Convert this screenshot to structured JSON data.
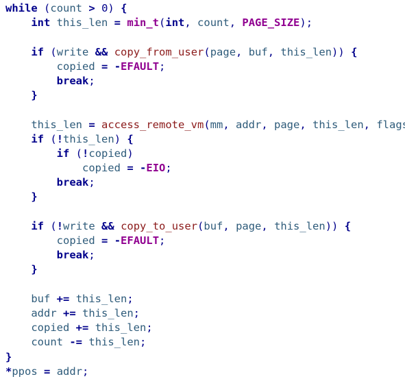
{
  "editor": {
    "language": "c",
    "background_color": "#ffffff",
    "font_size_px": 15.5,
    "line_height_px": 21.2,
    "tab_width_spaces": 4,
    "theme": {
      "keyword_color": "#00008b",
      "macro_color": "#900090",
      "function_color": "#8b1a1a",
      "identifier_color": "#2e5b7a",
      "operator_color": "#00008b",
      "number_color": "#00008b"
    }
  },
  "code": {
    "lines": [
      {
        "index": 1,
        "text": "while (count > 0) {",
        "tokens": [
          {
            "t": "while",
            "c": "t-kw"
          },
          {
            "t": " ",
            "c": "t-plain"
          },
          {
            "t": "(",
            "c": "t-pun"
          },
          {
            "t": "count",
            "c": "t-var"
          },
          {
            "t": " ",
            "c": "t-plain"
          },
          {
            "t": ">",
            "c": "t-op"
          },
          {
            "t": " ",
            "c": "t-plain"
          },
          {
            "t": "0",
            "c": "t-num"
          },
          {
            "t": ")",
            "c": "t-pun"
          },
          {
            "t": " ",
            "c": "t-plain"
          },
          {
            "t": "{",
            "c": "t-brace"
          }
        ]
      },
      {
        "index": 2,
        "text": "    int this_len = min_t(int, count, PAGE_SIZE);",
        "tokens": [
          {
            "t": "    ",
            "c": "t-plain"
          },
          {
            "t": "int",
            "c": "t-kw"
          },
          {
            "t": " ",
            "c": "t-plain"
          },
          {
            "t": "this_len",
            "c": "t-var"
          },
          {
            "t": " ",
            "c": "t-plain"
          },
          {
            "t": "=",
            "c": "t-op"
          },
          {
            "t": " ",
            "c": "t-plain"
          },
          {
            "t": "min_t",
            "c": "t-mac"
          },
          {
            "t": "(",
            "c": "t-pun"
          },
          {
            "t": "int",
            "c": "t-kw"
          },
          {
            "t": ", ",
            "c": "t-pun"
          },
          {
            "t": "count",
            "c": "t-var"
          },
          {
            "t": ", ",
            "c": "t-pun"
          },
          {
            "t": "PAGE_SIZE",
            "c": "t-mac"
          },
          {
            "t": ");",
            "c": "t-pun"
          }
        ]
      },
      {
        "index": 3,
        "text": "",
        "tokens": []
      },
      {
        "index": 4,
        "text": "    if (write && copy_from_user(page, buf, this_len)) {",
        "tokens": [
          {
            "t": "    ",
            "c": "t-plain"
          },
          {
            "t": "if",
            "c": "t-kw"
          },
          {
            "t": " ",
            "c": "t-plain"
          },
          {
            "t": "(",
            "c": "t-pun"
          },
          {
            "t": "write",
            "c": "t-var"
          },
          {
            "t": " ",
            "c": "t-plain"
          },
          {
            "t": "&&",
            "c": "t-op"
          },
          {
            "t": " ",
            "c": "t-plain"
          },
          {
            "t": "copy_from_user",
            "c": "t-fn"
          },
          {
            "t": "(",
            "c": "t-pun"
          },
          {
            "t": "page",
            "c": "t-var"
          },
          {
            "t": ", ",
            "c": "t-pun"
          },
          {
            "t": "buf",
            "c": "t-var"
          },
          {
            "t": ", ",
            "c": "t-pun"
          },
          {
            "t": "this_len",
            "c": "t-var"
          },
          {
            "t": "))",
            "c": "t-pun"
          },
          {
            "t": " ",
            "c": "t-plain"
          },
          {
            "t": "{",
            "c": "t-brace"
          }
        ]
      },
      {
        "index": 5,
        "text": "        copied = -EFAULT;",
        "tokens": [
          {
            "t": "        ",
            "c": "t-plain"
          },
          {
            "t": "copied",
            "c": "t-var"
          },
          {
            "t": " ",
            "c": "t-plain"
          },
          {
            "t": "=",
            "c": "t-op"
          },
          {
            "t": " ",
            "c": "t-plain"
          },
          {
            "t": "-",
            "c": "t-op"
          },
          {
            "t": "EFAULT",
            "c": "t-mac"
          },
          {
            "t": ";",
            "c": "t-pun"
          }
        ]
      },
      {
        "index": 6,
        "text": "        break;",
        "tokens": [
          {
            "t": "        ",
            "c": "t-plain"
          },
          {
            "t": "break",
            "c": "t-kw"
          },
          {
            "t": ";",
            "c": "t-pun"
          }
        ]
      },
      {
        "index": 7,
        "text": "    }",
        "tokens": [
          {
            "t": "    ",
            "c": "t-plain"
          },
          {
            "t": "}",
            "c": "t-brace"
          }
        ]
      },
      {
        "index": 8,
        "text": "",
        "tokens": []
      },
      {
        "index": 9,
        "text": "    this_len = access_remote_vm(mm, addr, page, this_len, flags)",
        "tokens": [
          {
            "t": "    ",
            "c": "t-plain"
          },
          {
            "t": "this_len",
            "c": "t-var"
          },
          {
            "t": " ",
            "c": "t-plain"
          },
          {
            "t": "=",
            "c": "t-op"
          },
          {
            "t": " ",
            "c": "t-plain"
          },
          {
            "t": "access_remote_vm",
            "c": "t-fn"
          },
          {
            "t": "(",
            "c": "t-pun"
          },
          {
            "t": "mm",
            "c": "t-var"
          },
          {
            "t": ", ",
            "c": "t-pun"
          },
          {
            "t": "addr",
            "c": "t-var"
          },
          {
            "t": ", ",
            "c": "t-pun"
          },
          {
            "t": "page",
            "c": "t-var"
          },
          {
            "t": ", ",
            "c": "t-pun"
          },
          {
            "t": "this_len",
            "c": "t-var"
          },
          {
            "t": ", ",
            "c": "t-pun"
          },
          {
            "t": "flags",
            "c": "t-var"
          },
          {
            "t": ")",
            "c": "t-pun"
          }
        ]
      },
      {
        "index": 10,
        "text": "    if (!this_len) {",
        "tokens": [
          {
            "t": "    ",
            "c": "t-plain"
          },
          {
            "t": "if",
            "c": "t-kw"
          },
          {
            "t": " ",
            "c": "t-plain"
          },
          {
            "t": "(",
            "c": "t-pun"
          },
          {
            "t": "!",
            "c": "t-op"
          },
          {
            "t": "this_len",
            "c": "t-var"
          },
          {
            "t": ")",
            "c": "t-pun"
          },
          {
            "t": " ",
            "c": "t-plain"
          },
          {
            "t": "{",
            "c": "t-brace"
          }
        ]
      },
      {
        "index": 11,
        "text": "        if (!copied)",
        "tokens": [
          {
            "t": "        ",
            "c": "t-plain"
          },
          {
            "t": "if",
            "c": "t-kw"
          },
          {
            "t": " ",
            "c": "t-plain"
          },
          {
            "t": "(",
            "c": "t-pun"
          },
          {
            "t": "!",
            "c": "t-op"
          },
          {
            "t": "copied",
            "c": "t-var"
          },
          {
            "t": ")",
            "c": "t-pun"
          }
        ]
      },
      {
        "index": 12,
        "text": "            copied = -EIO;",
        "tokens": [
          {
            "t": "            ",
            "c": "t-plain"
          },
          {
            "t": "copied",
            "c": "t-var"
          },
          {
            "t": " ",
            "c": "t-plain"
          },
          {
            "t": "=",
            "c": "t-op"
          },
          {
            "t": " ",
            "c": "t-plain"
          },
          {
            "t": "-",
            "c": "t-op"
          },
          {
            "t": "EIO",
            "c": "t-mac"
          },
          {
            "t": ";",
            "c": "t-pun"
          }
        ]
      },
      {
        "index": 13,
        "text": "        break;",
        "tokens": [
          {
            "t": "        ",
            "c": "t-plain"
          },
          {
            "t": "break",
            "c": "t-kw"
          },
          {
            "t": ";",
            "c": "t-pun"
          }
        ]
      },
      {
        "index": 14,
        "text": "    }",
        "tokens": [
          {
            "t": "    ",
            "c": "t-plain"
          },
          {
            "t": "}",
            "c": "t-brace"
          }
        ]
      },
      {
        "index": 15,
        "text": "",
        "tokens": []
      },
      {
        "index": 16,
        "text": "    if (!write && copy_to_user(buf, page, this_len)) {",
        "tokens": [
          {
            "t": "    ",
            "c": "t-plain"
          },
          {
            "t": "if",
            "c": "t-kw"
          },
          {
            "t": " ",
            "c": "t-plain"
          },
          {
            "t": "(",
            "c": "t-pun"
          },
          {
            "t": "!",
            "c": "t-op"
          },
          {
            "t": "write",
            "c": "t-var"
          },
          {
            "t": " ",
            "c": "t-plain"
          },
          {
            "t": "&&",
            "c": "t-op"
          },
          {
            "t": " ",
            "c": "t-plain"
          },
          {
            "t": "copy_to_user",
            "c": "t-fn"
          },
          {
            "t": "(",
            "c": "t-pun"
          },
          {
            "t": "buf",
            "c": "t-var"
          },
          {
            "t": ", ",
            "c": "t-pun"
          },
          {
            "t": "page",
            "c": "t-var"
          },
          {
            "t": ", ",
            "c": "t-pun"
          },
          {
            "t": "this_len",
            "c": "t-var"
          },
          {
            "t": "))",
            "c": "t-pun"
          },
          {
            "t": " ",
            "c": "t-plain"
          },
          {
            "t": "{",
            "c": "t-brace"
          }
        ]
      },
      {
        "index": 17,
        "text": "        copied = -EFAULT;",
        "tokens": [
          {
            "t": "        ",
            "c": "t-plain"
          },
          {
            "t": "copied",
            "c": "t-var"
          },
          {
            "t": " ",
            "c": "t-plain"
          },
          {
            "t": "=",
            "c": "t-op"
          },
          {
            "t": " ",
            "c": "t-plain"
          },
          {
            "t": "-",
            "c": "t-op"
          },
          {
            "t": "EFAULT",
            "c": "t-mac"
          },
          {
            "t": ";",
            "c": "t-pun"
          }
        ]
      },
      {
        "index": 18,
        "text": "        break;",
        "tokens": [
          {
            "t": "        ",
            "c": "t-plain"
          },
          {
            "t": "break",
            "c": "t-kw"
          },
          {
            "t": ";",
            "c": "t-pun"
          }
        ]
      },
      {
        "index": 19,
        "text": "    }",
        "tokens": [
          {
            "t": "    ",
            "c": "t-plain"
          },
          {
            "t": "}",
            "c": "t-brace"
          }
        ]
      },
      {
        "index": 20,
        "text": "",
        "tokens": []
      },
      {
        "index": 21,
        "text": "    buf += this_len;",
        "tokens": [
          {
            "t": "    ",
            "c": "t-plain"
          },
          {
            "t": "buf",
            "c": "t-var"
          },
          {
            "t": " ",
            "c": "t-plain"
          },
          {
            "t": "+=",
            "c": "t-op"
          },
          {
            "t": " ",
            "c": "t-plain"
          },
          {
            "t": "this_len",
            "c": "t-var"
          },
          {
            "t": ";",
            "c": "t-pun"
          }
        ]
      },
      {
        "index": 22,
        "text": "    addr += this_len;",
        "tokens": [
          {
            "t": "    ",
            "c": "t-plain"
          },
          {
            "t": "addr",
            "c": "t-var"
          },
          {
            "t": " ",
            "c": "t-plain"
          },
          {
            "t": "+=",
            "c": "t-op"
          },
          {
            "t": " ",
            "c": "t-plain"
          },
          {
            "t": "this_len",
            "c": "t-var"
          },
          {
            "t": ";",
            "c": "t-pun"
          }
        ]
      },
      {
        "index": 23,
        "text": "    copied += this_len;",
        "tokens": [
          {
            "t": "    ",
            "c": "t-plain"
          },
          {
            "t": "copied",
            "c": "t-var"
          },
          {
            "t": " ",
            "c": "t-plain"
          },
          {
            "t": "+=",
            "c": "t-op"
          },
          {
            "t": " ",
            "c": "t-plain"
          },
          {
            "t": "this_len",
            "c": "t-var"
          },
          {
            "t": ";",
            "c": "t-pun"
          }
        ]
      },
      {
        "index": 24,
        "text": "    count -= this_len;",
        "tokens": [
          {
            "t": "    ",
            "c": "t-plain"
          },
          {
            "t": "count",
            "c": "t-var"
          },
          {
            "t": " ",
            "c": "t-plain"
          },
          {
            "t": "-=",
            "c": "t-op"
          },
          {
            "t": " ",
            "c": "t-plain"
          },
          {
            "t": "this_len",
            "c": "t-var"
          },
          {
            "t": ";",
            "c": "t-pun"
          }
        ]
      },
      {
        "index": 25,
        "text": "}",
        "tokens": [
          {
            "t": "}",
            "c": "t-brace"
          }
        ]
      },
      {
        "index": 26,
        "text": "*ppos = addr;",
        "tokens": [
          {
            "t": "*",
            "c": "t-op"
          },
          {
            "t": "ppos",
            "c": "t-var"
          },
          {
            "t": " ",
            "c": "t-plain"
          },
          {
            "t": "=",
            "c": "t-op"
          },
          {
            "t": " ",
            "c": "t-plain"
          },
          {
            "t": "addr",
            "c": "t-var"
          },
          {
            "t": ";",
            "c": "t-pun"
          }
        ]
      }
    ]
  }
}
